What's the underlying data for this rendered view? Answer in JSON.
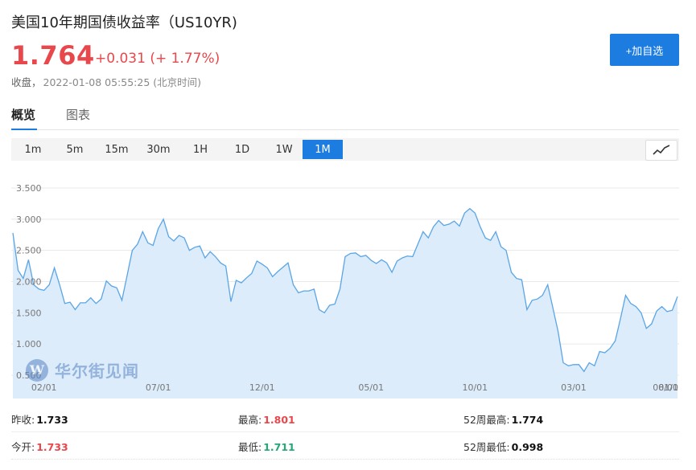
{
  "header": {
    "title": "美国10年期国债收益率（US10YR)",
    "price": "1.764",
    "change": "+0.031 (+ 1.77%)",
    "status_label": "收盘，",
    "timestamp": "2022-01-08 05:55:25 (北京时间)",
    "follow_button": "+加自选"
  },
  "tabs": [
    {
      "label": "概览",
      "active": true
    },
    {
      "label": "图表",
      "active": false
    }
  ],
  "periods": [
    "1m",
    "5m",
    "15m",
    "30m",
    "1H",
    "1D",
    "1W",
    "1M"
  ],
  "active_period": "1M",
  "watermark": {
    "logo": "W",
    "text": "华尔街见闻"
  },
  "colors": {
    "accent": "#1c7ce0",
    "up": "#e8474c",
    "down": "#25a776",
    "line": "#5aa5e6",
    "fill": "#dcecfb"
  },
  "chart_data": {
    "type": "area",
    "ylim": [
      0.5,
      3.6
    ],
    "yticks": [
      "0.500",
      "1.000",
      "1.500",
      "2.000",
      "2.500",
      "3.000",
      "3.500"
    ],
    "ytick_values": [
      0.5,
      1.0,
      1.5,
      2.0,
      2.5,
      3.0,
      3.5
    ],
    "xticks": [
      {
        "label": "02/01",
        "index": 6
      },
      {
        "label": "07/01",
        "index": 28
      },
      {
        "label": "12/01",
        "index": 48
      },
      {
        "label": "05/01",
        "index": 69
      },
      {
        "label": "10/01",
        "index": 89
      },
      {
        "label": "03/01",
        "index": 108
      },
      {
        "label": "08/01",
        "index": 129
      },
      {
        "label": "01/0",
        "index": 149
      }
    ],
    "grid": true,
    "values": [
      2.78,
      2.18,
      2.05,
      2.35,
      1.95,
      1.88,
      1.86,
      1.95,
      2.22,
      1.95,
      1.65,
      1.67,
      1.55,
      1.66,
      1.66,
      1.74,
      1.65,
      1.72,
      2.01,
      1.93,
      1.9,
      1.7,
      2.1,
      2.5,
      2.6,
      2.8,
      2.62,
      2.58,
      2.85,
      3.0,
      2.72,
      2.65,
      2.74,
      2.7,
      2.5,
      2.55,
      2.57,
      2.38,
      2.48,
      2.4,
      2.3,
      2.25,
      1.68,
      2.02,
      1.98,
      2.06,
      2.13,
      2.33,
      2.28,
      2.22,
      2.08,
      2.16,
      2.23,
      2.3,
      1.95,
      1.82,
      1.85,
      1.85,
      1.88,
      1.55,
      1.5,
      1.62,
      1.64,
      1.88,
      2.4,
      2.45,
      2.46,
      2.4,
      2.42,
      2.34,
      2.29,
      2.35,
      2.3,
      2.15,
      2.33,
      2.38,
      2.41,
      2.4,
      2.6,
      2.8,
      2.7,
      2.88,
      2.98,
      2.9,
      2.92,
      2.97,
      2.89,
      3.1,
      3.17,
      3.1,
      2.88,
      2.7,
      2.66,
      2.8,
      2.56,
      2.5,
      2.15,
      2.05,
      2.03,
      1.55,
      1.7,
      1.72,
      1.78,
      1.95,
      1.58,
      1.2,
      0.7,
      0.65,
      0.67,
      0.67,
      0.56,
      0.7,
      0.65,
      0.88,
      0.86,
      0.93,
      1.05,
      1.4,
      1.78,
      1.65,
      1.6,
      1.5,
      1.25,
      1.32,
      1.53,
      1.6,
      1.52,
      1.54,
      1.76
    ]
  },
  "stats": {
    "prev_close_label": "昨收:",
    "prev_close": "1.733",
    "high_label": "最高:",
    "high": "1.801",
    "w52_high_label": "52周最高:",
    "w52_high": "1.774",
    "open_label": "今开:",
    "open": "1.733",
    "low_label": "最低:",
    "low": "1.711",
    "w52_low_label": "52周最低:",
    "w52_low": "0.998"
  }
}
